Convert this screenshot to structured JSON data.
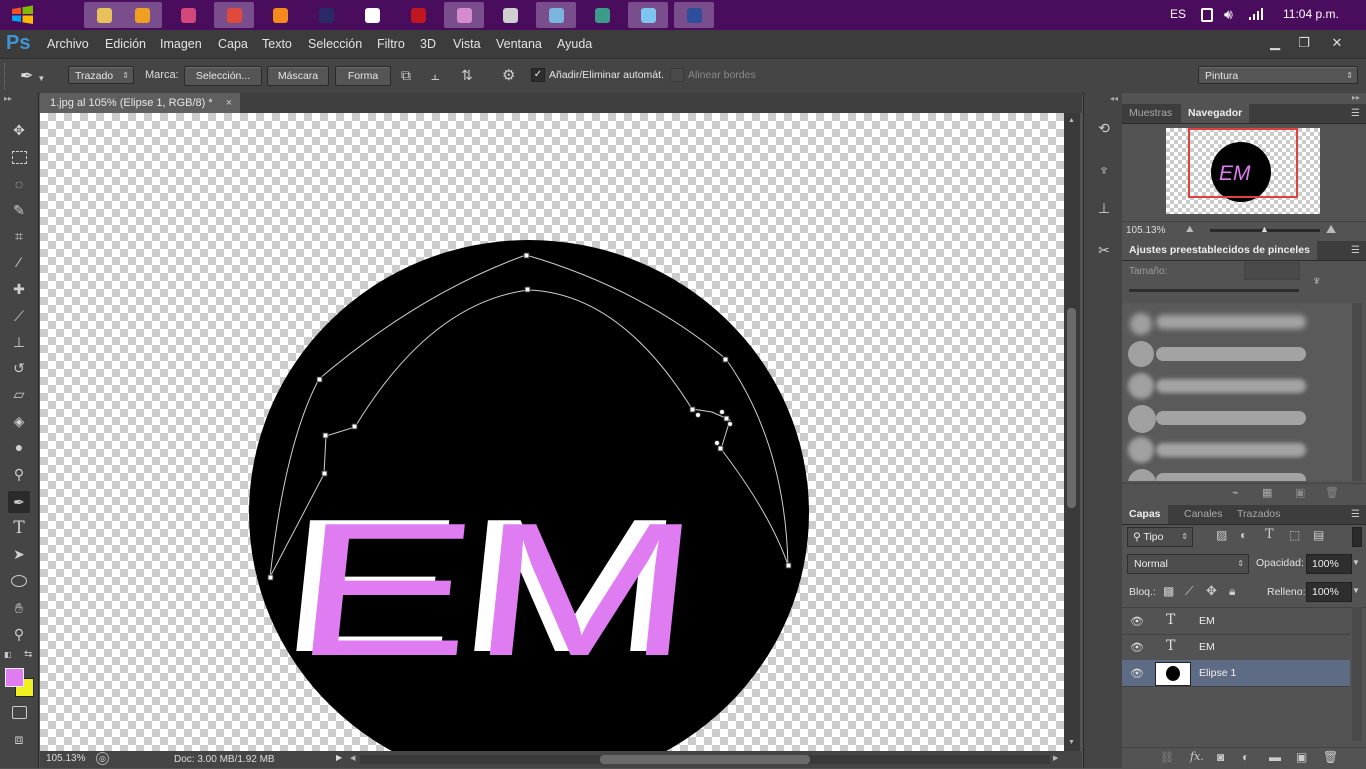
{
  "taskbar": {
    "icons": [
      {
        "name": "windows-start-icon"
      },
      {
        "name": "file-explorer-icon",
        "color": "#e8c15a",
        "active": true
      },
      {
        "name": "media-player-icon",
        "color": "#f0a020",
        "active": true
      },
      {
        "name": "brain-app-icon",
        "color": "#d2487a",
        "active": false
      },
      {
        "name": "chrome-icon",
        "color": "#e04a3a",
        "active": true
      },
      {
        "name": "illustrator-icon",
        "color": "#f28a1c",
        "active": false
      },
      {
        "name": "premiere-icon",
        "color": "#2a2a6a",
        "active": false
      },
      {
        "name": "inkscape-icon",
        "color": "#ffffff",
        "active": false
      },
      {
        "name": "music-app-icon",
        "color": "#c0161f",
        "active": false
      },
      {
        "name": "paint-app-icon",
        "color": "#d78bcf",
        "active": true
      },
      {
        "name": "usb-icon",
        "color": "#cfcfcf",
        "active": false
      },
      {
        "name": "keyboard-icon",
        "color": "#7ab6e0",
        "active": true
      },
      {
        "name": "arrow-app-icon",
        "color": "#3d9b8a",
        "active": false
      },
      {
        "name": "notepad-icon",
        "color": "#7ec6f0",
        "active": true
      },
      {
        "name": "photoshop-taskbar-icon",
        "color": "#2d4f9b",
        "active": true
      }
    ],
    "lang": "ES",
    "time": "11:04 p.m."
  },
  "app": {
    "logo": "Ps",
    "menus": [
      "Archivo",
      "Edición",
      "Imagen",
      "Capa",
      "Texto",
      "Selección",
      "Filtro",
      "3D",
      "Vista",
      "Ventana",
      "Ayuda"
    ]
  },
  "options": {
    "mode_select": "Trazado",
    "marca_label": "Marca:",
    "seleccion_btn": "Selección...",
    "mascara_btn": "Máscara",
    "forma_btn": "Forma",
    "auto_add_label": "Añadir/Eliminar automát.",
    "auto_add_checked": true,
    "align_edges_label": "Alinear bordes",
    "align_edges_checked": false,
    "workspace_select": "Pintura"
  },
  "document": {
    "tab_title": "1.jpg al 105% (Elipse 1, RGB/8) *",
    "artwork_text": "EM",
    "artwork_fill": "#e07cf2",
    "zoom": "105.13%",
    "doc_size": "Doc: 3.00 MB/1.92 MB"
  },
  "colors": {
    "foreground": "#e07cf2",
    "background": "#f0f020",
    "accent_selected_layer": "#5e6b84"
  },
  "navigator": {
    "tabs": [
      "Muestras",
      "Navegador"
    ],
    "active_tab": "Navegador",
    "zoom": "105.13%",
    "thumb_text": "EM"
  },
  "brushes": {
    "title": "Ajustes preestablecidos de pinceles",
    "size_label": "Tamaño:"
  },
  "layers": {
    "tabs": [
      "Capas",
      "Canales",
      "Trazados"
    ],
    "active_tab": "Capas",
    "filter_select": "Tipo",
    "blend_mode": "Normal",
    "opacity_label": "Opacidad:",
    "opacity": "100%",
    "lock_label": "Bloq.:",
    "fill_label": "Relleno:",
    "fill": "100%",
    "items": [
      {
        "name": "EM",
        "kind": "text",
        "selected": false
      },
      {
        "name": "EM",
        "kind": "text",
        "selected": false
      },
      {
        "name": "Elipse 1",
        "kind": "shape",
        "selected": true
      }
    ]
  }
}
